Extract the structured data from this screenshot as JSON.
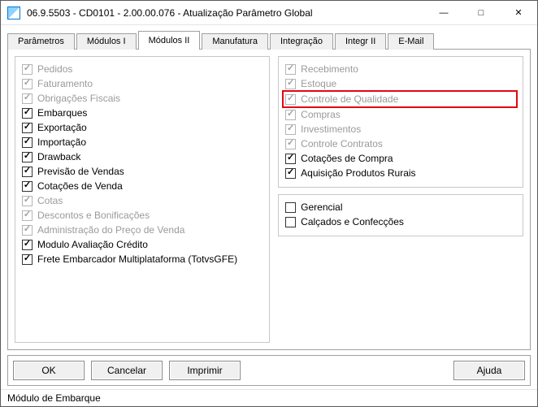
{
  "window": {
    "title": "06.9.5503 - CD0101 - 2.00.00.076 - Atualização Parâmetro Global"
  },
  "tabs": [
    {
      "label": "Parâmetros",
      "active": false
    },
    {
      "label": "Módulos I",
      "active": false
    },
    {
      "label": "Módulos II",
      "active": true
    },
    {
      "label": "Manufatura",
      "active": false
    },
    {
      "label": "Integração",
      "active": false
    },
    {
      "label": "Integr II",
      "active": false
    },
    {
      "label": "E-Mail",
      "active": false
    }
  ],
  "left_group": {
    "items": [
      {
        "label": "Pedidos",
        "checked": true,
        "enabled": false
      },
      {
        "label": "Faturamento",
        "checked": true,
        "enabled": false
      },
      {
        "label": "Obrigações Fiscais",
        "checked": true,
        "enabled": false
      },
      {
        "label": "Embarques",
        "checked": true,
        "enabled": true
      },
      {
        "label": "Exportação",
        "checked": true,
        "enabled": true
      },
      {
        "label": "Importação",
        "checked": true,
        "enabled": true
      },
      {
        "label": "Drawback",
        "checked": true,
        "enabled": true
      },
      {
        "label": "Previsão de Vendas",
        "checked": true,
        "enabled": true
      },
      {
        "label": "Cotações de Venda",
        "checked": true,
        "enabled": true
      },
      {
        "label": "Cotas",
        "checked": true,
        "enabled": false
      },
      {
        "label": "Descontos e Bonificações",
        "checked": true,
        "enabled": false
      },
      {
        "label": "Administração do Preço de Venda",
        "checked": true,
        "enabled": false
      },
      {
        "label": "Modulo Avaliação Crédito",
        "checked": true,
        "enabled": true
      },
      {
        "label": "Frete Embarcador Multiplataforma (TotvsGFE)",
        "checked": true,
        "enabled": true
      }
    ]
  },
  "right_group_1": {
    "items": [
      {
        "label": "Recebimento",
        "checked": true,
        "enabled": false,
        "highlight": false
      },
      {
        "label": "Estoque",
        "checked": true,
        "enabled": false,
        "highlight": false
      },
      {
        "label": "Controle de Qualidade",
        "checked": true,
        "enabled": false,
        "highlight": true
      },
      {
        "label": "Compras",
        "checked": true,
        "enabled": false,
        "highlight": false
      },
      {
        "label": "Investimentos",
        "checked": true,
        "enabled": false,
        "highlight": false
      },
      {
        "label": "Controle Contratos",
        "checked": true,
        "enabled": false,
        "highlight": false
      },
      {
        "label": "Cotações de Compra",
        "checked": true,
        "enabled": true,
        "highlight": false
      },
      {
        "label": "Aquisição Produtos Rurais",
        "checked": true,
        "enabled": true,
        "highlight": false
      }
    ]
  },
  "right_group_2": {
    "items": [
      {
        "label": "Gerencial",
        "checked": false,
        "enabled": true
      },
      {
        "label": "Calçados e Confecções",
        "checked": false,
        "enabled": true
      }
    ]
  },
  "buttons": {
    "ok": "OK",
    "cancelar": "Cancelar",
    "imprimir": "Imprimir",
    "ajuda": "Ajuda"
  },
  "status": "Módulo de Embarque"
}
